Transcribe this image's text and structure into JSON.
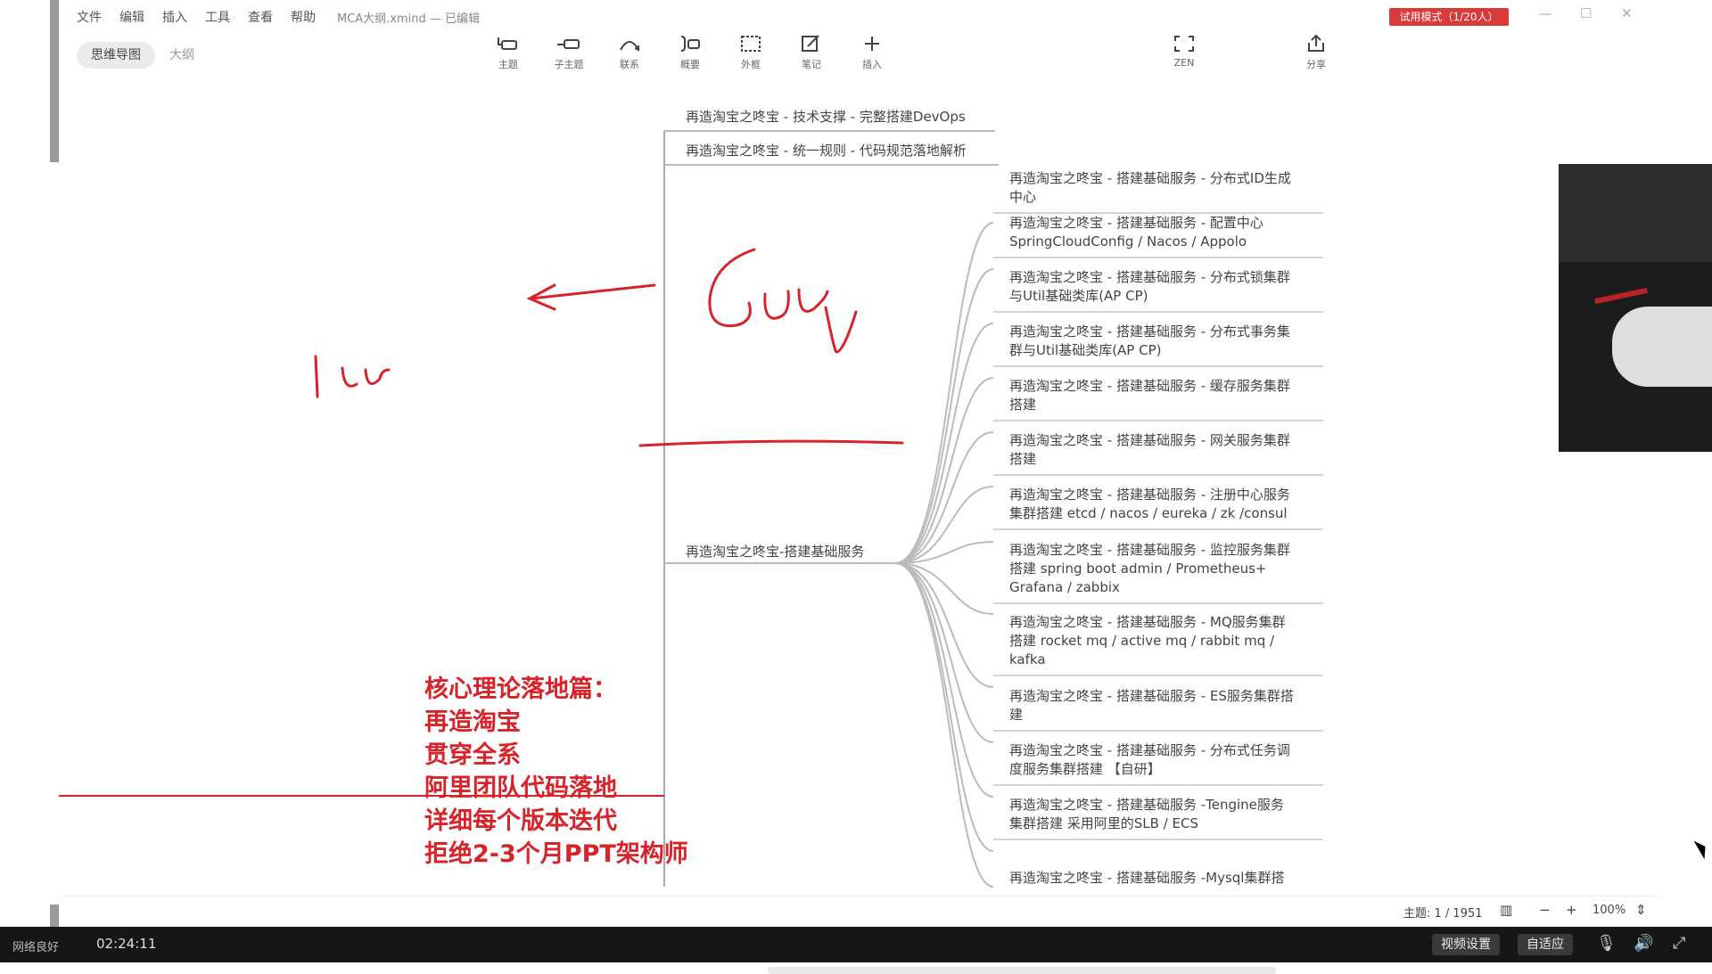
{
  "menu": [
    "文件",
    "编辑",
    "插入",
    "工具",
    "查看",
    "帮助"
  ],
  "doc_title": "MCA大纲.xmind — 已编辑",
  "trial_badge": "试用模式（1/20人）",
  "view_tabs": {
    "mindmap": "思维导图",
    "outline": "大纲"
  },
  "toolbar": [
    {
      "label": "主题",
      "icon": "topic-icon"
    },
    {
      "label": "子主题",
      "icon": "subtopic-icon"
    },
    {
      "label": "联系",
      "icon": "relationship-icon"
    },
    {
      "label": "概要",
      "icon": "summary-icon"
    },
    {
      "label": "外框",
      "icon": "boundary-icon"
    },
    {
      "label": "笔记",
      "icon": "note-icon"
    },
    {
      "label": "插入",
      "icon": "insert-icon"
    }
  ],
  "zen_label": "ZEN",
  "share_label": "分享",
  "mindmap": {
    "branches_top": [
      "再造淘宝之咚宝 - 技术支撑 - 完整搭建DevOps",
      "再造淘宝之咚宝 - 统一规则 - 代码规范落地解析"
    ],
    "main_branch": "再造淘宝之咚宝-搭建基础服务",
    "subtopics": [
      [
        "再造淘宝之咚宝 - 搭建基础服务 - 分布式ID生成",
        "中心"
      ],
      [
        "再造淘宝之咚宝 - 搭建基础服务 - 配置中心",
        "SpringCloudConfig / Nacos / Appolo"
      ],
      [
        "再造淘宝之咚宝 - 搭建基础服务 - 分布式锁集群",
        "与Util基础类库(AP CP)"
      ],
      [
        "再造淘宝之咚宝 - 搭建基础服务 - 分布式事务集",
        "群与Util基础类库(AP CP)"
      ],
      [
        "再造淘宝之咚宝 - 搭建基础服务 - 缓存服务集群",
        "搭建"
      ],
      [
        "再造淘宝之咚宝 - 搭建基础服务 - 网关服务集群",
        "搭建"
      ],
      [
        "再造淘宝之咚宝 - 搭建基础服务 - 注册中心服务",
        "集群搭建 etcd / nacos / eureka / zk /consul"
      ],
      [
        "再造淘宝之咚宝 - 搭建基础服务 - 监控服务集群",
        "搭建 spring boot admin / Prometheus+",
        "Grafana / zabbix"
      ],
      [
        "再造淘宝之咚宝 - 搭建基础服务 - MQ服务集群",
        "搭建 rocket mq / active mq / rabbit mq /",
        "kafka"
      ],
      [
        "再造淘宝之咚宝 - 搭建基础服务 - ES服务集群搭",
        "建"
      ],
      [
        "再造淘宝之咚宝 - 搭建基础服务 - 分布式任务调",
        "度服务集群搭建 【自研】"
      ],
      [
        "再造淘宝之咚宝 - 搭建基础服务 -Tengine服务",
        "集群搭建 采用阿里的SLB / ECS"
      ],
      [
        "再造淘宝之咚宝 - 搭建基础服务 -Mysql集群搭"
      ]
    ]
  },
  "callout_lines": [
    "核心理论落地篇：",
    "再造淘宝",
    "贯穿全系",
    "阿里团队代码落地",
    "详细每个版本迭代",
    "拒绝2-3个月PPT架构师"
  ],
  "annotation_color": "#d8232a",
  "statusbar": {
    "topic_count": "主题: 1 / 1951",
    "zoom": "100%"
  },
  "player": {
    "network": "网络良好",
    "time": "02:24:11",
    "settings_btn": "视频设置",
    "quality_btn": "自适应"
  }
}
